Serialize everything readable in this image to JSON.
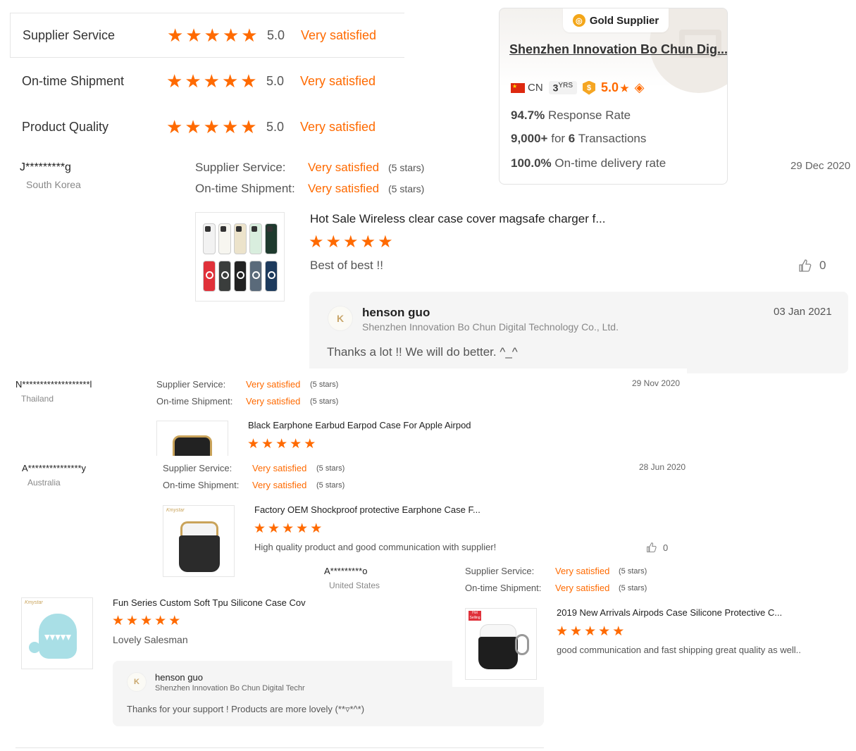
{
  "summary": {
    "rows": [
      {
        "label": "Supplier Service",
        "score": "5.0",
        "status": "Very satisfied"
      },
      {
        "label": "On-time Shipment",
        "score": "5.0",
        "status": "Very satisfied"
      },
      {
        "label": "Product Quality",
        "score": "5.0",
        "status": "Very satisfied"
      }
    ],
    "star_color": "#ff6a00"
  },
  "supplier_card": {
    "badge": "Gold Supplier",
    "name": "Shenzhen Innovation Bo Chun Dig...",
    "country": "CN",
    "years": "3",
    "years_unit": "YRS",
    "rating": "5.0",
    "rating_star": "★",
    "response_rate_value": "94.7%",
    "response_rate_label": "Response Rate",
    "transactions_amount": "9,000+",
    "transactions_for": "for",
    "transactions_count": "6",
    "transactions_label": "Transactions",
    "ontime_value": "100.0%",
    "ontime_label": "On-time delivery rate"
  },
  "reviews": [
    {
      "reviewer": "J*********g",
      "country": "South Korea",
      "date": "29 Dec 2020",
      "supplier_service_label": "Supplier Service:",
      "supplier_service": "Very satisfied",
      "supplier_service_stars": "(5 stars)",
      "shipment_label": "On-time Shipment:",
      "shipment": "Very satisfied",
      "shipment_stars": "(5 stars)",
      "product_title": "Hot Sale Wireless clear case cover magsafe charger f...",
      "comment": "Best of best !!",
      "likes": "0",
      "reply": {
        "name": "henson guo",
        "company": "Shenzhen Innovation Bo Chun Digital Technology Co., Ltd.",
        "date": "03 Jan 2021",
        "text": "Thanks a lot !! We will do better.  ^_^"
      }
    },
    {
      "reviewer": "N*******************l",
      "country": "Thailand",
      "date": "29 Nov 2020",
      "supplier_service_label": "Supplier Service:",
      "supplier_service": "Very satisfied",
      "supplier_service_stars": "(5 stars)",
      "shipment_label": "On-time Shipment:",
      "shipment": "Very satisfied",
      "shipment_stars": "(5 stars)",
      "product_title": "Black Earphone Earbud Earpod Case For Apple Airpod"
    },
    {
      "reviewer": "A***************y",
      "country": "Australia",
      "date": "28 Jun 2020",
      "supplier_service_label": "Supplier Service:",
      "supplier_service": "Very satisfied",
      "supplier_service_stars": "(5 stars)",
      "shipment_label": "On-time Shipment:",
      "shipment": "Very satisfied",
      "shipment_stars": "(5 stars)",
      "product_title": "Factory OEM Shockproof protective Earphone Case F...",
      "comment": "High quality product and good communication with supplier!",
      "likes": "0"
    },
    {
      "product_title": "Fun Series Custom Soft Tpu Silicone Case Cov",
      "comment": "Lovely Salesman",
      "reply": {
        "name": "henson guo",
        "company": "Shenzhen Innovation Bo Chun Digital Techr",
        "text": "Thanks for your support !  Products are more lovely (**▿*^*)"
      }
    },
    {
      "reviewer": "A*********o",
      "country": "United States",
      "supplier_service_label": "Supplier Service:",
      "supplier_service": "Very satisfied",
      "supplier_service_stars": "(5 stars)",
      "shipment_label": "On-time Shipment:",
      "shipment": "Very satisfied",
      "shipment_stars": "(5 stars)",
      "product_title": "2019 New Arrivals Airpods Case Silicone Protective C...",
      "comment": "good communication and fast shipping great quality as well.."
    }
  ],
  "icons": {
    "star": "★",
    "thumb": "thumbs-up-icon",
    "gold": "gold-supplier-icon",
    "verified": "verified-icon",
    "diamond": "diamond-icon"
  },
  "logo_text": "Kmystar",
  "hot_label": "Hot Selling"
}
